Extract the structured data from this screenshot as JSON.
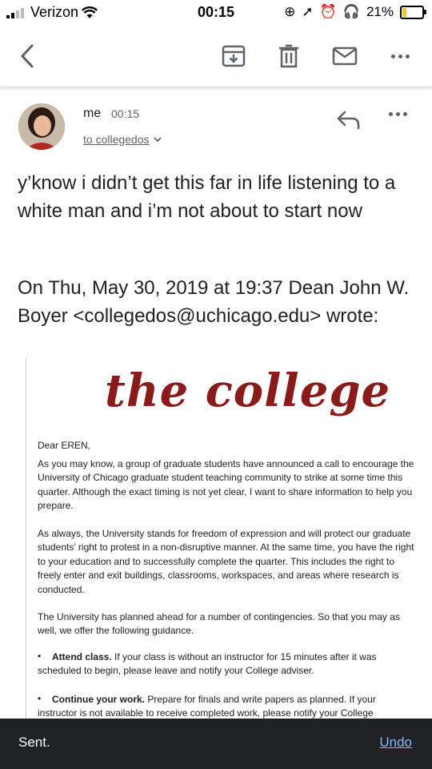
{
  "status_bar": {
    "carrier": "Verizon",
    "time": "00:15",
    "battery_percent": "21%",
    "battery_level": 0.21
  },
  "toolbar": {
    "back_icon": "chevron-left-icon",
    "archive_icon": "archive-icon",
    "delete_icon": "trash-icon",
    "mark_unread_icon": "mail-icon",
    "more_icon": "more-horizontal-icon"
  },
  "email": {
    "sender": "me",
    "time": "00:15",
    "recipients": "to collegedos",
    "message": "y’know i didn’t get this far in life listening to a white man and i’m not about to start now",
    "quote_header": "On Thu, May 30, 2019 at 19:37 Dean John W. Boyer <collegedos@uchicago.edu> wrote:",
    "quoted": {
      "logo_text": "the college",
      "greeting": "Dear EREN,",
      "p1": "As you may know, a group of graduate students have announced a call to encourage the University of Chicago graduate student teaching community to strike at some time this quarter. Although the exact timing is not yet clear, I want to share information to help you prepare.",
      "p2": "As always, the University stands for freedom of expression and will protect our graduate students’ right to protest in a non-disruptive manner. At the same time, you have the right to your education and to successfully complete the quarter. This includes the right to freely enter and exit buildings, classrooms, workspaces, and areas where research is conducted.",
      "p3": "The University has planned ahead for a number of contingencies. So that you may as well, we offer the following guidance.",
      "b1_title": "Attend class.",
      "b1_text": " If your class is without an instructor for 15 minutes after it was scheduled to begin, please leave and notify your College adviser.",
      "b2_title": "Continue your work.",
      "b2_text": " Prepare for finals and write papers as planned. If your instructor is not available to receive completed work, please notify your College"
    }
  },
  "snackbar": {
    "text": "Sent.",
    "action": "Undo"
  }
}
